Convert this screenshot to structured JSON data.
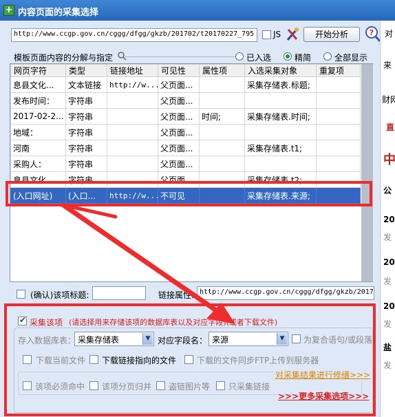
{
  "window": {
    "title": "内容页面的采集选择"
  },
  "url_bar": {
    "url": "http://www.ccgp.gov.cn/cggg/dfgg/gkzb/201702/t20170227_795",
    "js_label": "JS",
    "analyze_button": "开始分析"
  },
  "section": {
    "title": "模板页面内容的分解与指定",
    "radio_selected": "已入选",
    "radio_fine": "精简",
    "radio_all": "全部显示"
  },
  "grid": {
    "columns": [
      "网页字符",
      "类型",
      "链接地址",
      "可见性",
      "属性项",
      "入选采集对象",
      "重复项"
    ],
    "rows": [
      [
        "息县文化...",
        "文本链接",
        "http://w...",
        "父页面...",
        "",
        "采集存储表.标题;",
        ""
      ],
      [
        "发布时间：",
        "字符串",
        "",
        "父页面...",
        "",
        "",
        ""
      ],
      [
        "2017-02-2...",
        "字符串",
        "",
        "父页面...",
        "时间;",
        "采集存储表.时间;",
        ""
      ],
      [
        "地域：",
        "字符串",
        "",
        "父页面...",
        "",
        "",
        ""
      ],
      [
        "河南",
        "字符串",
        "",
        "父页面...",
        "",
        "采集存储表.t1;",
        ""
      ],
      [
        "采购人：",
        "字符串",
        "",
        "父页面...",
        "",
        "",
        ""
      ],
      [
        "息县文化...",
        "字符串",
        "",
        "父页面...",
        "",
        "采集存储表.t2;",
        ""
      ],
      [
        "(入口网址)",
        "(入口...",
        "http://w...",
        "不可见",
        "",
        "采集存储表.来源;",
        ""
      ]
    ]
  },
  "confirm": {
    "label": "(确认)该项标题:",
    "title_value": "",
    "link_attr_label": "链接属性:",
    "link_attr_value": "http://www.ccgp.gov.cn/cggg/dfgg/gkzb/2017"
  },
  "collect": {
    "checkbox_label": "采集该项",
    "hint": "(请选择用来存储该项的数据库表以及对应字段)(或者下载文件)",
    "table_label": "存入数据库表：",
    "table_value": "采集存储表",
    "field_label": "对应字段名：",
    "field_value": "来源",
    "compound_label": "为复合语句/或段落",
    "download_current": "下载当前文件",
    "download_link": "下载链接指向的文件",
    "download_ftp": "下载的文件同步FTP上传到服务器",
    "modify_link": "对采集结果进行修缮>>>",
    "must_hit": "该项必须命中",
    "page_merge": "该项分页归并",
    "steal_image": "盗链图片等",
    "link_only": "只采集链接",
    "more_options": ">>>更多采集选项>>>"
  },
  "side_panel": {
    "item1": "对",
    "item2": "来",
    "item3": "财网",
    "item4": "直",
    "item5": "中",
    "item6": "公",
    "item7": "20",
    "item8": "发",
    "item9": "20",
    "item10": "发",
    "item11": "20",
    "item12": "发",
    "item13": "盐",
    "item14": "发"
  },
  "colors": {
    "highlight_red": "#ef2b2b",
    "selection_blue": "#3367c2",
    "title_blue": "#2f78cf"
  }
}
